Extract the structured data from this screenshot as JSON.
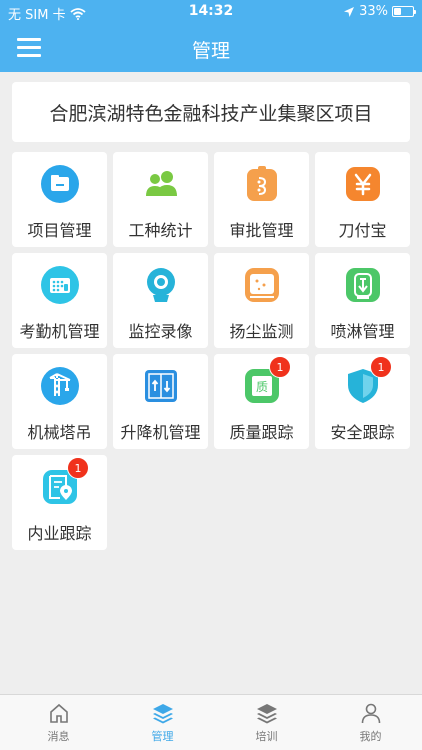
{
  "status_bar": {
    "carrier": "无 SIM 卡",
    "time": "14:32",
    "battery": "33%",
    "battery_level": 0.33
  },
  "header": {
    "title": "管理"
  },
  "project": {
    "name": "合肥滨湖特色金融科技产业集聚区项目"
  },
  "grid": [
    {
      "label": "项目管理",
      "icon": "folder-icon",
      "color": "#2aa6ea"
    },
    {
      "label": "工种统计",
      "icon": "users-icon",
      "color": "#7ac943"
    },
    {
      "label": "审批管理",
      "icon": "approval-icon",
      "color": "#f5a04c"
    },
    {
      "label": "刀付宝",
      "icon": "yen-icon",
      "color": "#f5862e"
    },
    {
      "label": "考勤机管理",
      "icon": "attendance-icon",
      "color": "#2ec4e6"
    },
    {
      "label": "监控录像",
      "icon": "camera-icon",
      "color": "#26b3d9"
    },
    {
      "label": "扬尘监测",
      "icon": "dust-monitor-icon",
      "color": "#f5a04c"
    },
    {
      "label": "喷淋管理",
      "icon": "sprinkler-icon",
      "color": "#4cc768"
    },
    {
      "label": "机械塔吊",
      "icon": "tower-crane-icon",
      "color": "#2aa6ea"
    },
    {
      "label": "升降机管理",
      "icon": "elevator-icon",
      "color": "#2a8fe0"
    },
    {
      "label": "质量跟踪",
      "icon": "quality-icon",
      "color": "#4cc768",
      "badge": "1",
      "icon_text": "质"
    },
    {
      "label": "安全跟踪",
      "icon": "shield-icon",
      "color": "#26b3d9",
      "badge": "1"
    },
    {
      "label": "内业跟踪",
      "icon": "document-location-icon",
      "color": "#2ec4e6",
      "badge": "1"
    }
  ],
  "tabs": [
    {
      "label": "消息",
      "icon": "home-icon",
      "active": false
    },
    {
      "label": "管理",
      "icon": "layers-icon",
      "active": true
    },
    {
      "label": "培训",
      "icon": "layers-icon",
      "active": false
    },
    {
      "label": "我的",
      "icon": "person-icon",
      "active": false
    }
  ]
}
